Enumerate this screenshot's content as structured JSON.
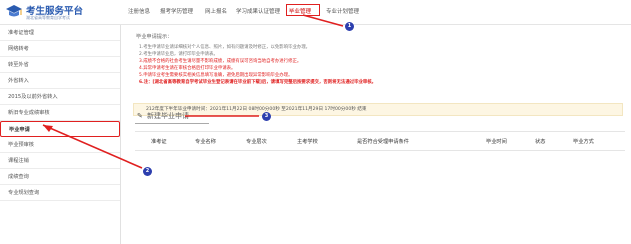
{
  "app": {
    "title": "考生服务平台",
    "subtitle": "湖北省高等教育自学考试"
  },
  "nav": {
    "items": [
      {
        "label": "注册信息"
      },
      {
        "label": "报考学历管理"
      },
      {
        "label": "网上报名"
      },
      {
        "label": "学习成果认证管理"
      },
      {
        "label": "毕业管理",
        "active": true
      },
      {
        "label": "专业计划管理"
      }
    ]
  },
  "sidebar": {
    "items": [
      {
        "label": "准考证管理"
      },
      {
        "label": "网络转考"
      },
      {
        "label": "转至外省"
      },
      {
        "label": "外省转入"
      },
      {
        "label": "2015及以前外省转入"
      },
      {
        "label": "新旧专业成绩审核"
      },
      {
        "label": "毕业申请",
        "active": true
      },
      {
        "label": "毕业预审核"
      },
      {
        "label": "课程注销"
      },
      {
        "label": "成绩查询"
      },
      {
        "label": "专业规划查询"
      }
    ]
  },
  "main": {
    "tips_title": "毕业申请提示：",
    "tips": [
      {
        "text": "1.考生申请毕业请详细核对个人信息、照片，如有问题请及时修正，以免影响毕业办理。",
        "style": "gray"
      },
      {
        "text": "2.考生申请毕业后，请打印毕业申请表。",
        "style": "gray"
      },
      {
        "text": "3.成绩不合格的社会考生请尽量不影响成绩，成绩有误可咨询当地自考办进行修正。",
        "style": "red"
      },
      {
        "text": "4.异常申请考生请在审核合格后打印毕业申请表。",
        "style": "red"
      },
      {
        "text": "5.申请毕业考生需要核实相关信息填写准确，避免后期出现异常影响毕业办理。",
        "style": "red"
      },
      {
        "text": "6.注：[湖北省高等教育自学考试毕业生登记表请在毕业前下载]后，请填写完整后按要求提交，否则将无法通过毕业审核。",
        "style": "red-bold"
      }
    ],
    "period_text": "212年度下半年毕业申请时间：2021年11月22日 08时00分00秒 至2021年11月29日 17时00分00秒 结束",
    "new_apply_label": "新建毕业申请",
    "table_headers": [
      "准考证",
      "专业名称",
      "专业层次",
      "主考学校",
      "是否符合受理申请条件",
      "毕业时间",
      "状态",
      "毕业方式"
    ]
  },
  "annotations": [
    "1",
    "2",
    "3"
  ],
  "colors": {
    "brand": "#2a5bb0",
    "highlight": "#e02020",
    "annotation_badge": "#2d3fae",
    "period_bg": "#fdf6e3"
  }
}
